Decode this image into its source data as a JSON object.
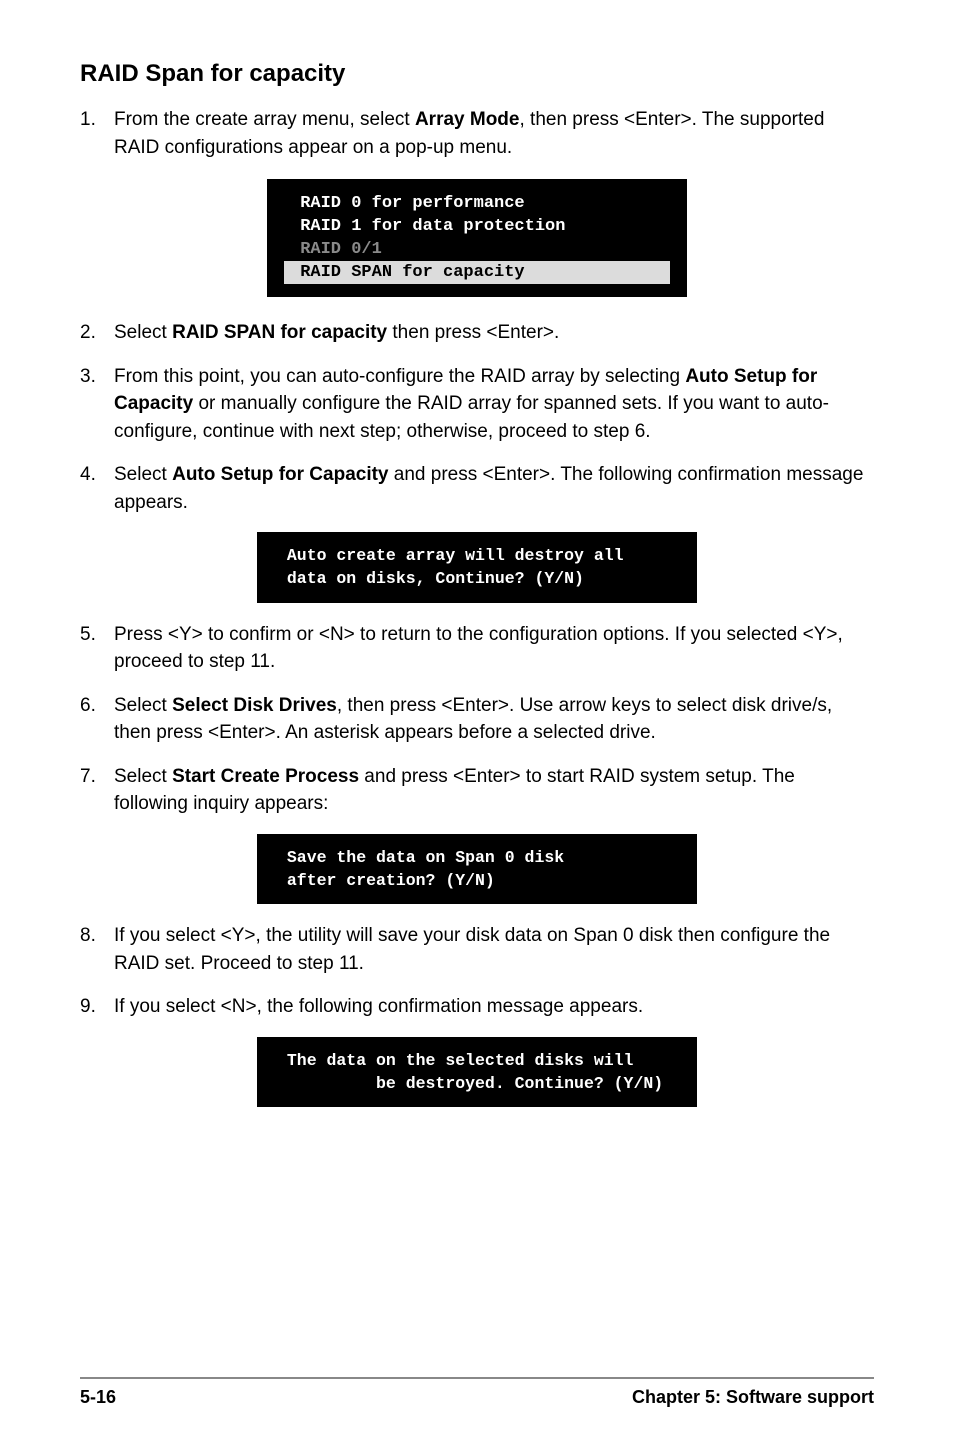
{
  "title": "RAID Span for capacity",
  "steps": [
    {
      "num": "1.",
      "html": "From the create array menu, select <b>Array Mode</b>, then press <Enter>. The supported RAID configurations appear on a pop-up menu."
    },
    {
      "num": "2.",
      "html": "Select <b>RAID SPAN for capacity</b> then press <Enter>."
    },
    {
      "num": "3.",
      "html": "From this point, you can auto-configure the RAID array by selecting <b>Auto Setup for Capacity</b> or manually configure the RAID array for spanned sets. If you want to auto-configure, continue with next step; otherwise, proceed to step 6."
    },
    {
      "num": "4.",
      "html": "Select  <b>Auto Setup for Capacity</b> and press <Enter>. The following confirmation message appears."
    },
    {
      "num": "5.",
      "html": "Press <Y> to confirm or <N> to return to the configuration options. If you selected <Y>, proceed to step 11."
    },
    {
      "num": "6.",
      "html": "Select <b>Select Disk Drives</b>, then press <Enter>. Use arrow keys to select disk drive/s, then press <Enter>. An asterisk appears before a selected drive."
    },
    {
      "num": "7.",
      "html": "Select <b>Start Create Process</b> and press <Enter> to start RAID system setup. The following inquiry appears:"
    },
    {
      "num": "8.",
      "html": "If you select <Y>, the utility will save your disk data on Span 0 disk then configure the RAID set. Proceed to step 11."
    },
    {
      "num": "9.",
      "html": "If you select <N>, the following confirmation message appears."
    }
  ],
  "menu": {
    "line1": " RAID 0 for performance",
    "line2": " RAID 1 for data protection",
    "line3": " RAID 0/1",
    "line4": " RAID SPAN for capacity"
  },
  "box1": " Auto create array will destroy all\n data on disks, Continue? (Y/N)",
  "box2": " Save the data on Span 0 disk\n after creation? (Y/N)",
  "box3": " The data on the selected disks will\n          be destroyed. Continue? (Y/N)",
  "footer": {
    "left": "5-16",
    "right": "Chapter 5: Software support"
  }
}
